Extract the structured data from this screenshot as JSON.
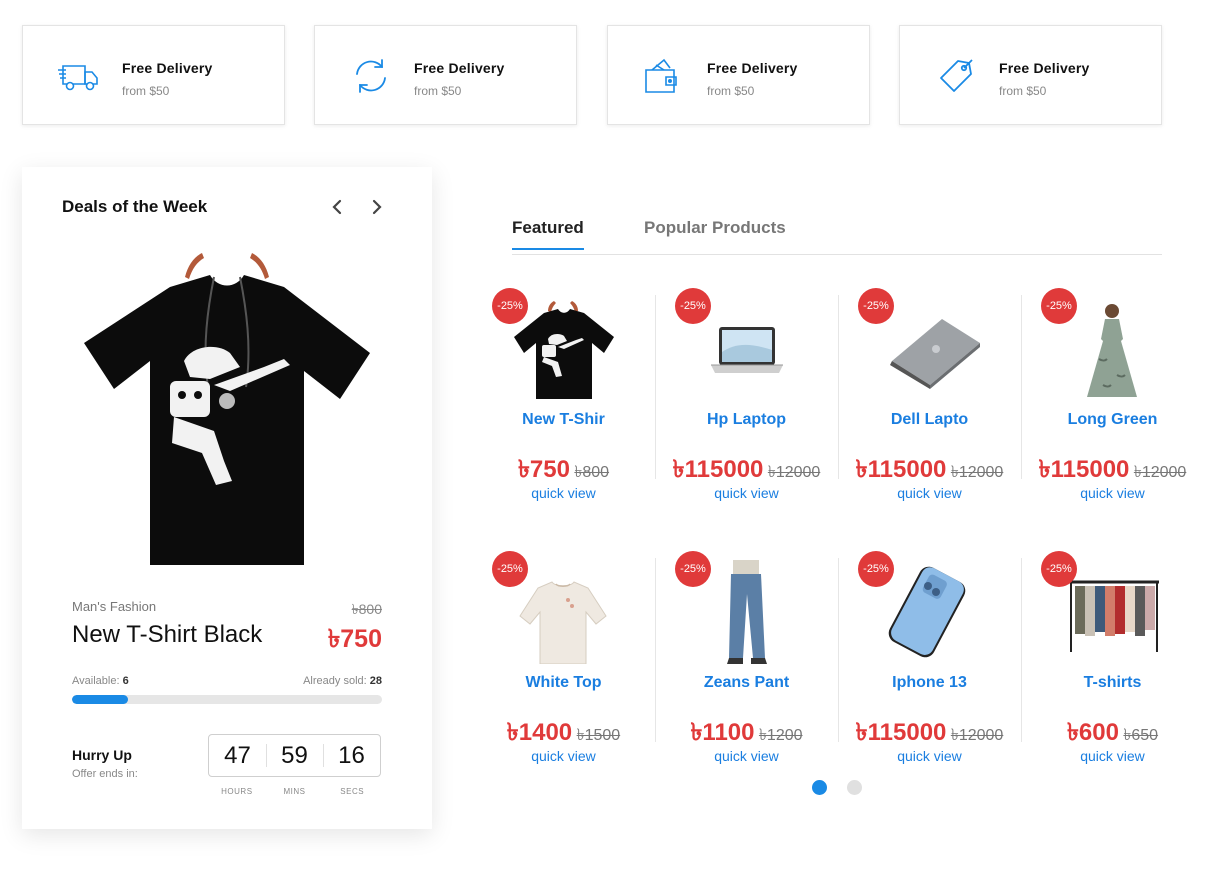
{
  "features": [
    {
      "title": "Free Delivery",
      "sub": "from $50",
      "icon": "truck-icon"
    },
    {
      "title": "Free Delivery",
      "sub": "from $50",
      "icon": "refresh-icon"
    },
    {
      "title": "Free Delivery",
      "sub": "from $50",
      "icon": "wallet-icon"
    },
    {
      "title": "Free Delivery",
      "sub": "from $50",
      "icon": "tag-icon"
    }
  ],
  "deal": {
    "title": "Deals of the Week",
    "category": "Man's Fashion",
    "old_price": "৳800",
    "name": "New T-Shirt Black",
    "price": "৳750",
    "available_label": "Available:",
    "available": "6",
    "sold_label": "Already sold:",
    "sold": "28",
    "progress_percent": 18,
    "hurry": "Hurry Up",
    "offer": "Offer ends in:",
    "timer": {
      "hours": "47",
      "mins": "59",
      "secs": "16"
    },
    "timer_labels": {
      "hours": "HOURS",
      "mins": "MINS",
      "secs": "SECS"
    }
  },
  "tabs": {
    "featured": "Featured",
    "popular": "Popular Products"
  },
  "products": [
    {
      "badge": "-25%",
      "name": "New T-Shir",
      "price": "৳750",
      "old": "৳800",
      "quick": "quick view"
    },
    {
      "badge": "-25%",
      "name": "Hp Laptop",
      "price": "৳115000",
      "old": "৳12000",
      "quick": "quick view"
    },
    {
      "badge": "-25%",
      "name": "Dell Lapto",
      "price": "৳115000",
      "old": "৳12000",
      "quick": "quick view"
    },
    {
      "badge": "-25%",
      "name": "Long Green",
      "price": "৳115000",
      "old": "৳12000",
      "quick": "quick view"
    },
    {
      "badge": "-25%",
      "name": "White Top",
      "price": "৳1400",
      "old": "৳1500",
      "quick": "quick view"
    },
    {
      "badge": "-25%",
      "name": "Zeans Pant",
      "price": "৳1100",
      "old": "৳1200",
      "quick": "quick view"
    },
    {
      "badge": "-25%",
      "name": "Iphone 13",
      "price": "৳115000",
      "old": "৳12000",
      "quick": "quick view"
    },
    {
      "badge": "-25%",
      "name": "T-shirts",
      "price": "৳600",
      "old": "৳650",
      "quick": "quick view"
    }
  ],
  "colors": {
    "accent": "#1a8ae5",
    "sale": "#e03a3a",
    "link": "#1a7ee0"
  }
}
